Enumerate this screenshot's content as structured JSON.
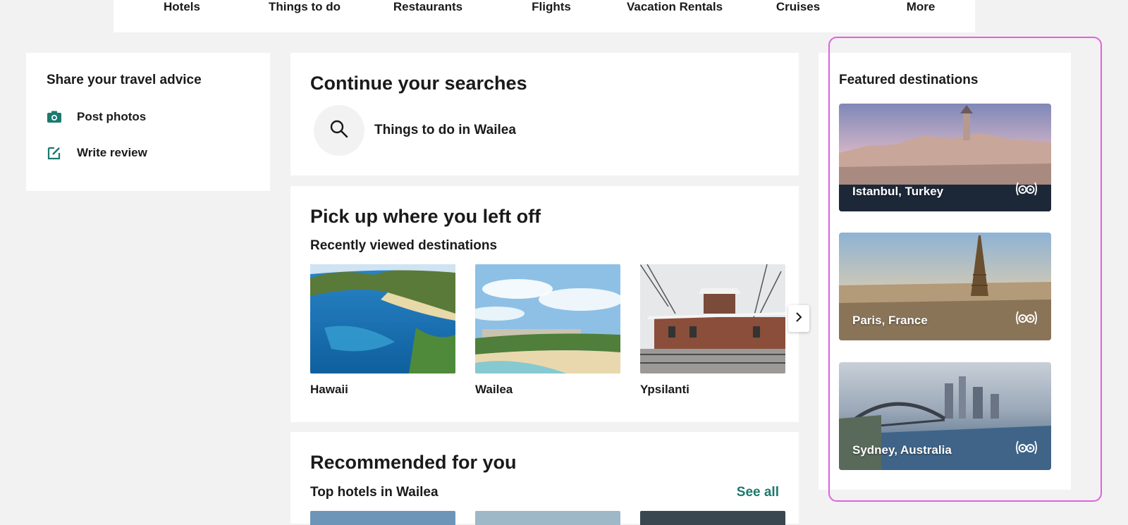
{
  "nav": {
    "items": [
      "Hotels",
      "Things to do",
      "Restaurants",
      "Flights",
      "Vacation Rentals",
      "Cruises",
      "More"
    ]
  },
  "advice": {
    "title": "Share your travel advice",
    "post_photos": "Post photos",
    "write_review": "Write review"
  },
  "continue_searches": {
    "title": "Continue your searches",
    "item": "Things to do in Wailea"
  },
  "pickup": {
    "title": "Pick up where you left off",
    "subtitle": "Recently viewed destinations",
    "destinations": [
      "Hawaii",
      "Wailea",
      "Ypsilanti"
    ]
  },
  "recommended": {
    "title": "Recommended for you",
    "subtitle": "Top hotels in Wailea",
    "see_all": "See all"
  },
  "featured": {
    "title": "Featured destinations",
    "items": [
      "Istanbul, Turkey",
      "Paris, France",
      "Sydney, Australia"
    ]
  },
  "colors": {
    "accent": "#1b7a6e",
    "highlight": "#e060e0",
    "background": "#f2f2f2"
  }
}
